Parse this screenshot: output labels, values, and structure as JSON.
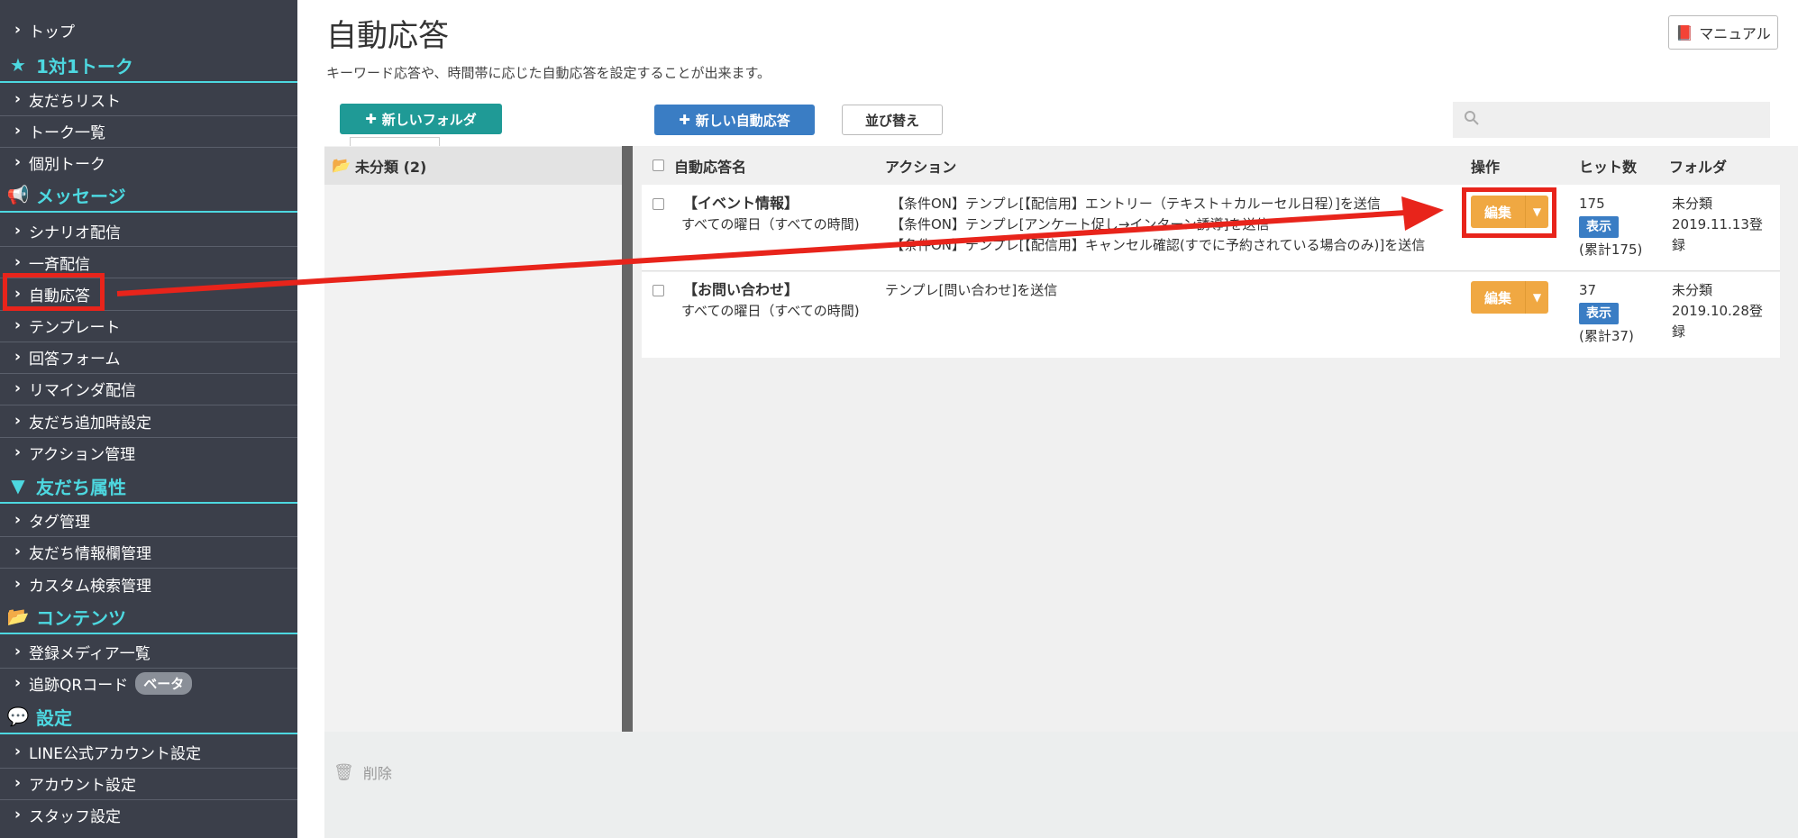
{
  "sidebar": {
    "items": [
      {
        "label": "トップ",
        "kind": "item"
      },
      {
        "label": "1対1トーク",
        "kind": "section",
        "icon": "star-icon"
      },
      {
        "label": "友だちリスト",
        "kind": "item"
      },
      {
        "label": "トーク一覧",
        "kind": "item"
      },
      {
        "label": "個別トーク",
        "kind": "item"
      },
      {
        "label": "メッセージ",
        "kind": "section",
        "icon": "megaphone-icon"
      },
      {
        "label": "シナリオ配信",
        "kind": "item"
      },
      {
        "label": "一斉配信",
        "kind": "item"
      },
      {
        "label": "自動応答",
        "kind": "item"
      },
      {
        "label": "テンプレート",
        "kind": "item"
      },
      {
        "label": "回答フォーム",
        "kind": "item"
      },
      {
        "label": "リマインダ配信",
        "kind": "item"
      },
      {
        "label": "友だち追加時設定",
        "kind": "item"
      },
      {
        "label": "アクション管理",
        "kind": "item"
      },
      {
        "label": "友だち属性",
        "kind": "section",
        "icon": "filter-icon"
      },
      {
        "label": "タグ管理",
        "kind": "item"
      },
      {
        "label": "友だち情報欄管理",
        "kind": "item"
      },
      {
        "label": "カスタム検索管理",
        "kind": "item"
      },
      {
        "label": "コンテンツ",
        "kind": "section",
        "icon": "folder-open-icon"
      },
      {
        "label": "登録メディア一覧",
        "kind": "item"
      },
      {
        "label": "追跡QRコード",
        "kind": "item",
        "badge": "ベータ"
      },
      {
        "label": "設定",
        "kind": "section",
        "icon": "speech-bubble-icon"
      },
      {
        "label": "LINE公式アカウント設定",
        "kind": "item"
      },
      {
        "label": "アカウント設定",
        "kind": "item"
      },
      {
        "label": "スタッフ設定",
        "kind": "item"
      }
    ]
  },
  "header": {
    "title": "自動応答",
    "description": "キーワード応答や、時間帯に応じた自動応答を設定することが出来ます。",
    "manual_label": "マニュアル"
  },
  "toolbar": {
    "new_folder_label": "新しいフォルダ",
    "new_auto_reply_label": "新しい自動応答",
    "sort_label": "並び替え",
    "search_placeholder": ""
  },
  "folders": [
    {
      "label": "未分類 (2)"
    }
  ],
  "table": {
    "headers": {
      "name": "自動応答名",
      "action": "アクション",
      "operation": "操作",
      "hits": "ヒット数",
      "folder": "フォルダ"
    },
    "rows": [
      {
        "name": "【イベント情報】",
        "schedule": "すべての曜日（すべての時間)",
        "actions": [
          "【条件ON】テンプレ[【配信用】エントリー（テキスト＋カルーセル日程）]を送信",
          "【条件ON】テンプレ[アンケート促し→インターン誘導]を送信",
          "【条件ON】テンプレ[【配信用】キャンセル確認(すでに予約されている場合のみ)]を送信"
        ],
        "edit_label": "編集",
        "hits": "175",
        "show_label": "表示",
        "total": "(累計175)",
        "folder": "未分類",
        "date": "2019.11.13登",
        "date2": "録"
      },
      {
        "name": "【お問い合わせ】",
        "schedule": "すべての曜日（すべての時間)",
        "actions": [
          "テンプレ[問い合わせ]を送信"
        ],
        "edit_label": "編集",
        "hits": "37",
        "show_label": "表示",
        "total": "(累計37)",
        "folder": "未分類",
        "date": "2019.10.28登",
        "date2": "録"
      }
    ]
  },
  "footer": {
    "delete_label": "削除"
  },
  "colors": {
    "sidebar_bg": "#3b3f4a",
    "section_accent": "#4dd8e0",
    "highlight_red": "#e8241b",
    "edit_orange": "#f0a842",
    "primary_blue": "#3a7dc4",
    "teal": "#1f9a96"
  }
}
